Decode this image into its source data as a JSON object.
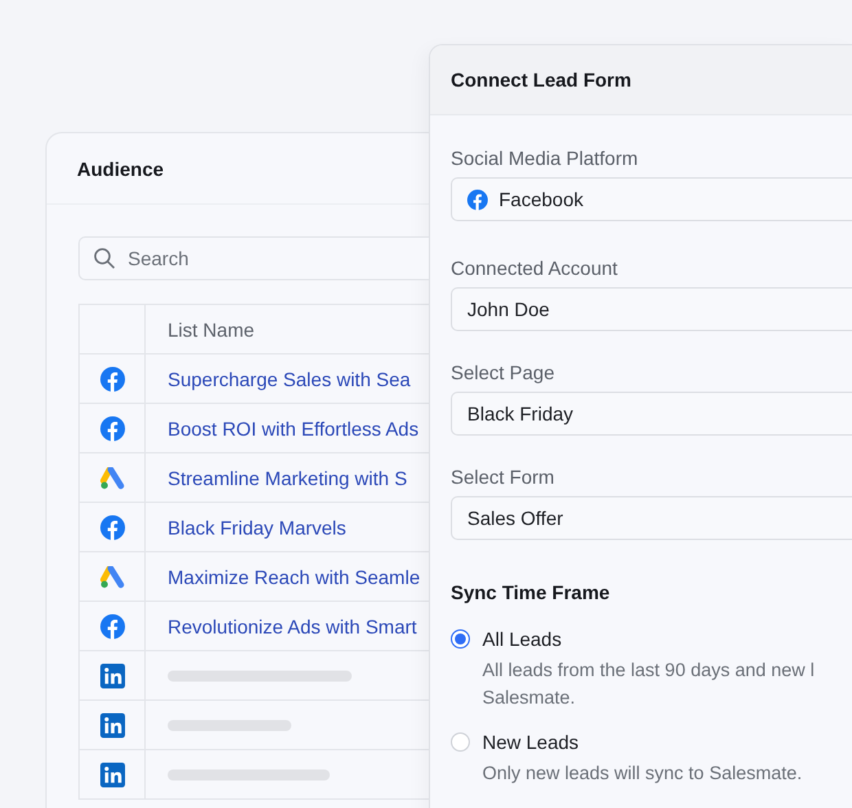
{
  "audience": {
    "title": "Audience",
    "search": {
      "placeholder": "Search"
    },
    "table": {
      "columns": [
        "List Name"
      ],
      "rows": [
        {
          "kind": "facebook",
          "name": "Supercharge Sales with Sea"
        },
        {
          "kind": "facebook",
          "name": "Boost ROI with Effortless Ads"
        },
        {
          "kind": "google_ads",
          "name": "Streamline Marketing with S"
        },
        {
          "kind": "facebook",
          "name": "Black Friday Marvels"
        },
        {
          "kind": "google_ads",
          "name": "Maximize Reach with Seamle"
        },
        {
          "kind": "facebook",
          "name": "Revolutionize Ads with Smart"
        },
        {
          "kind": "linkedin"
        },
        {
          "kind": "linkedin"
        },
        {
          "kind": "linkedin"
        }
      ]
    }
  },
  "lead_form": {
    "title": "Connect Lead Form",
    "fields": [
      {
        "label": "Social Media Platform",
        "value": "Facebook",
        "kind": "facebook"
      },
      {
        "label": "Connected Account",
        "value": "John Doe",
        "kind": "plain"
      },
      {
        "label": "Select Page",
        "value": "Black Friday",
        "kind": "plain"
      },
      {
        "label": "Select Form",
        "value": "Sales Offer",
        "kind": "plain"
      }
    ],
    "sync": {
      "title": "Sync Time Frame",
      "options": [
        {
          "label": "All Leads",
          "description": "All leads from the last 90 days and new l Salesmate.",
          "selected": true
        },
        {
          "label": "New Leads",
          "description": "Only new leads will sync to Salesmate.",
          "selected": false
        }
      ]
    }
  }
}
